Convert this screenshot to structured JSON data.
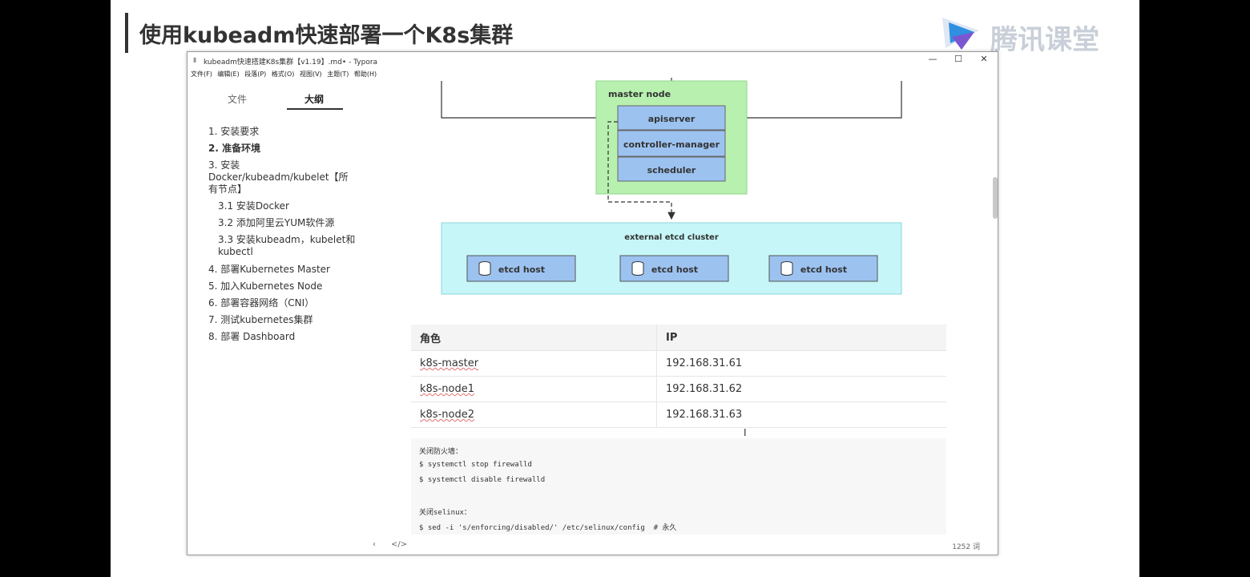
{
  "slide": {
    "title": "使用kubeadm快速部署一个K8s集群",
    "logo_text": "腾讯课堂",
    "logo_icon": "play-triangle-icon"
  },
  "window": {
    "title": "kubeadm快速搭建K8s集群【v1.19】.md• - Typora",
    "controls": {
      "minimize": "—",
      "maximize": "☐",
      "close": "✕"
    }
  },
  "menu": [
    "文件(F)",
    "编辑(E)",
    "段落(P)",
    "格式(O)",
    "视图(V)",
    "主题(T)",
    "帮助(H)"
  ],
  "sidebar": {
    "tabs": [
      {
        "label": "文件"
      },
      {
        "label": "大纲"
      }
    ],
    "active_tab": "大纲",
    "outline": [
      {
        "label": "1. 安装要求"
      },
      {
        "label": "2. 准备环境"
      },
      {
        "label": "3. 安装Docker/kubeadm/kubelet【所有节点】"
      },
      {
        "label": "3.1 安装Docker"
      },
      {
        "label": "3.2 添加阿里云YUM软件源"
      },
      {
        "label": "3.3 安装kubeadm，kubelet和kubectl"
      },
      {
        "label": "4. 部署Kubernetes Master"
      },
      {
        "label": "5. 加入Kubernetes Node"
      },
      {
        "label": "6. 部署容器网络（CNI）"
      },
      {
        "label": "7. 测试kubernetes集群"
      },
      {
        "label": "8. 部署 Dashboard"
      }
    ]
  },
  "diagram": {
    "master_label": "master node",
    "components": [
      "apiserver",
      "controller-manager",
      "scheduler"
    ],
    "etcd_cluster_label": "external etcd cluster",
    "etcd_hosts": [
      "etcd host",
      "etcd host",
      "etcd host"
    ]
  },
  "table": {
    "headers": [
      "角色",
      "IP"
    ],
    "rows": [
      [
        "k8s-master",
        "192.168.31.61"
      ],
      [
        "k8s-node1",
        "192.168.31.62"
      ],
      [
        "k8s-node2",
        "192.168.31.63"
      ]
    ]
  },
  "code": [
    "关闭防火墙：",
    "$ systemctl stop firewalld",
    "$ systemctl disable firewalld",
    "",
    "关闭selinux：",
    "$ sed -i 's/enforcing/disabled/' /etc/selinux/config  # 永久"
  ],
  "status": {
    "prev": "‹",
    "source": "</>",
    "word_count": "1252 词"
  }
}
